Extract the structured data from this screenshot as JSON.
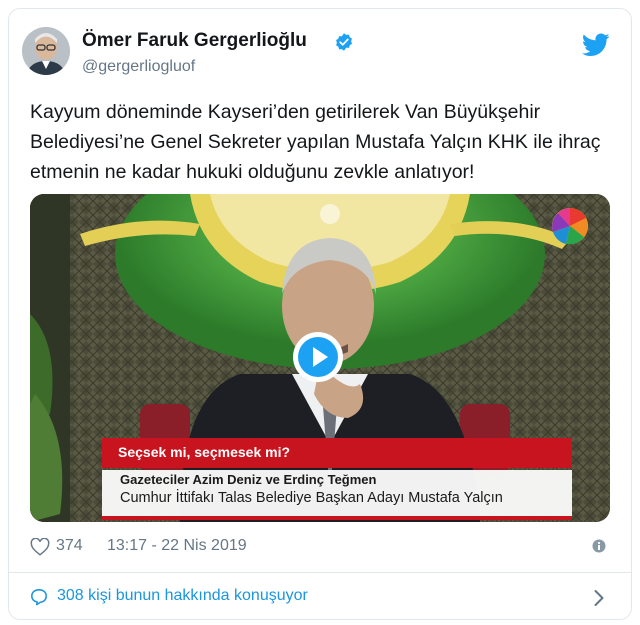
{
  "tweet": {
    "author_name": "Ömer Faruk Gergerlioğlu",
    "author_handle": "@gergerliogluof",
    "text": "Kayyum döneminde Kayseri’den getirilerek Van Büyükşehir Belediyesi’ne Genel Sekreter yapılan Mustafa Yalçın KHK ile ihraç etmenin ne kadar hukuki olduğunu zevkle anlatıyor!",
    "likes": "374",
    "timestamp": "13:17 - 22 Nis 2019",
    "conversation_label": "308 kişi bunun hakkında konuşuyor"
  },
  "video": {
    "caption_question": "Seçsek mi, seçmesek mi?",
    "caption_line1": "Gazeteciler Azim Deniz ve Erdinç Teğmen",
    "caption_line2": "Cumhur İttifakı Talas Belediye Başkan Adayı Mustafa Yalçın"
  },
  "icons": {
    "verified": "verified-badge-icon",
    "brand": "twitter-bird-icon",
    "like": "heart-icon",
    "info": "info-icon",
    "conversation": "speech-bubble-icon",
    "chevron": "chevron-right-icon",
    "play": "play-icon"
  },
  "colors": {
    "accent": "#1da1f2",
    "link": "#1b95e0",
    "muted": "#657786",
    "caption_red": "#c8141e"
  }
}
